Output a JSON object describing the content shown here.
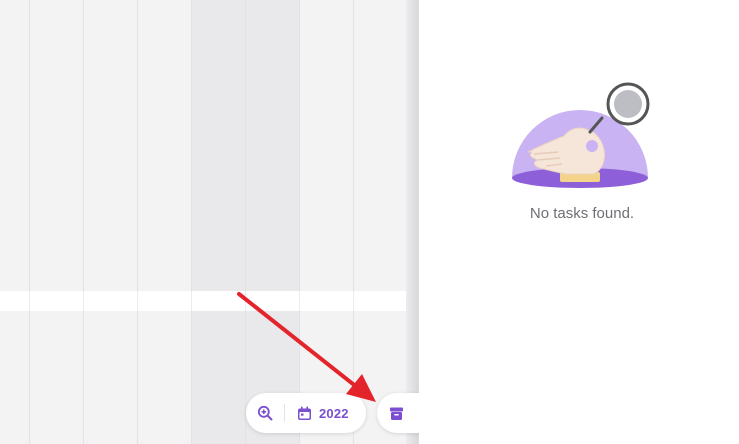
{
  "empty_state": {
    "message": "No tasks found."
  },
  "toolbar": {
    "zoom_icon": "zoom-in-icon",
    "calendar_icon": "calendar-icon",
    "year_label": "2022",
    "archive_icon": "archive-icon"
  },
  "colors": {
    "accent": "#7b4fcf",
    "accent_light": "#c9b3f2",
    "annotation": "#e3242b",
    "calendar_bg": "#f3f3f4",
    "text_muted": "#6f6f76"
  }
}
